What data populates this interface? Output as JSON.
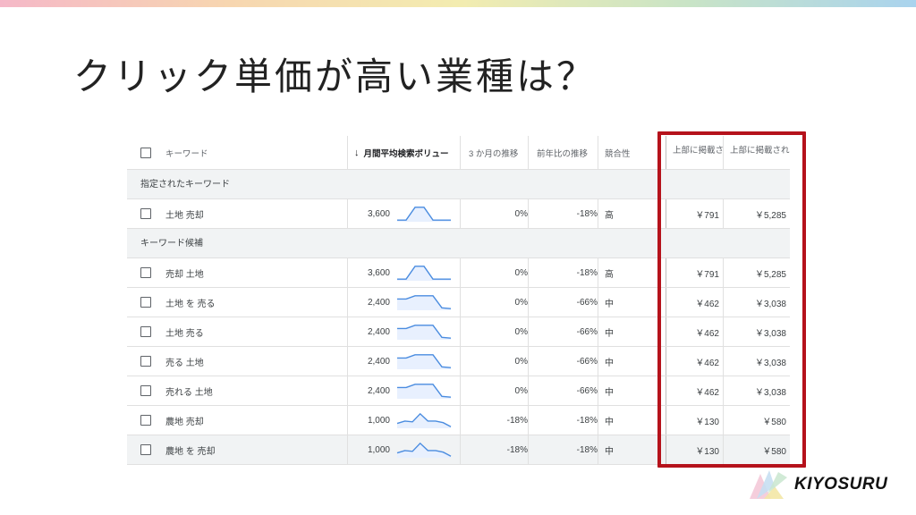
{
  "slide": {
    "title": "クリック単価が高い業種は？"
  },
  "table": {
    "headers": {
      "keyword": "キーワード",
      "volume_sort_icon": "arrow-down-icon",
      "volume_arrow": "↓",
      "volume": "月間平均検索ボリュー",
      "three_month": "3 か月の推移",
      "yoy": "前年比の推移",
      "competition": "競合性",
      "top_bid_low": "上部に掲載さ",
      "top_bid_high": "上部に掲載され"
    },
    "groups": [
      {
        "label": "指定されたキーワード",
        "rows": [
          {
            "keyword": "土地 売却",
            "volume": "3,600",
            "three_month": "0%",
            "yoy": "-18%",
            "competition": "高",
            "bid_low": "￥791",
            "bid_high": "￥5,285",
            "trend": [
              0.1,
              0.1,
              0.9,
              0.9,
              0.1,
              0.1,
              0.1
            ]
          }
        ]
      },
      {
        "label": "キーワード候補",
        "rows": [
          {
            "keyword": "売却 土地",
            "volume": "3,600",
            "three_month": "0%",
            "yoy": "-18%",
            "competition": "高",
            "bid_low": "￥791",
            "bid_high": "￥5,285",
            "trend": [
              0.1,
              0.1,
              0.9,
              0.9,
              0.1,
              0.1,
              0.1
            ]
          },
          {
            "keyword": "土地 を 売る",
            "volume": "2,400",
            "three_month": "0%",
            "yoy": "-66%",
            "competition": "中",
            "bid_low": "￥462",
            "bid_high": "￥3,038",
            "trend": [
              0.7,
              0.7,
              0.9,
              0.9,
              0.9,
              0.15,
              0.1
            ]
          },
          {
            "keyword": "土地 売る",
            "volume": "2,400",
            "three_month": "0%",
            "yoy": "-66%",
            "competition": "中",
            "bid_low": "￥462",
            "bid_high": "￥3,038",
            "trend": [
              0.7,
              0.7,
              0.9,
              0.9,
              0.9,
              0.15,
              0.1
            ]
          },
          {
            "keyword": "売る 土地",
            "volume": "2,400",
            "three_month": "0%",
            "yoy": "-66%",
            "competition": "中",
            "bid_low": "￥462",
            "bid_high": "￥3,038",
            "trend": [
              0.7,
              0.7,
              0.9,
              0.9,
              0.9,
              0.15,
              0.1
            ]
          },
          {
            "keyword": "売れる 土地",
            "volume": "2,400",
            "three_month": "0%",
            "yoy": "-66%",
            "competition": "中",
            "bid_low": "￥462",
            "bid_high": "￥3,038",
            "trend": [
              0.7,
              0.7,
              0.9,
              0.9,
              0.9,
              0.15,
              0.1
            ]
          },
          {
            "keyword": "農地 売却",
            "volume": "1,000",
            "three_month": "-18%",
            "yoy": "-18%",
            "competition": "中",
            "bid_low": "￥130",
            "bid_high": "￥580",
            "trend": [
              0.3,
              0.45,
              0.4,
              0.9,
              0.45,
              0.45,
              0.35,
              0.1
            ]
          },
          {
            "keyword": "農地 を 売却",
            "volume": "1,000",
            "three_month": "-18%",
            "yoy": "-18%",
            "competition": "中",
            "bid_low": "￥130",
            "bid_high": "￥580",
            "trend": [
              0.3,
              0.45,
              0.4,
              0.9,
              0.45,
              0.45,
              0.35,
              0.1
            ]
          }
        ]
      }
    ]
  },
  "colors": {
    "highlight": "#b5121b",
    "sparkline": "#4a8ce0",
    "sparkline_fill": "#e8f0fe"
  },
  "logo": {
    "text": "KIYOSURU"
  }
}
